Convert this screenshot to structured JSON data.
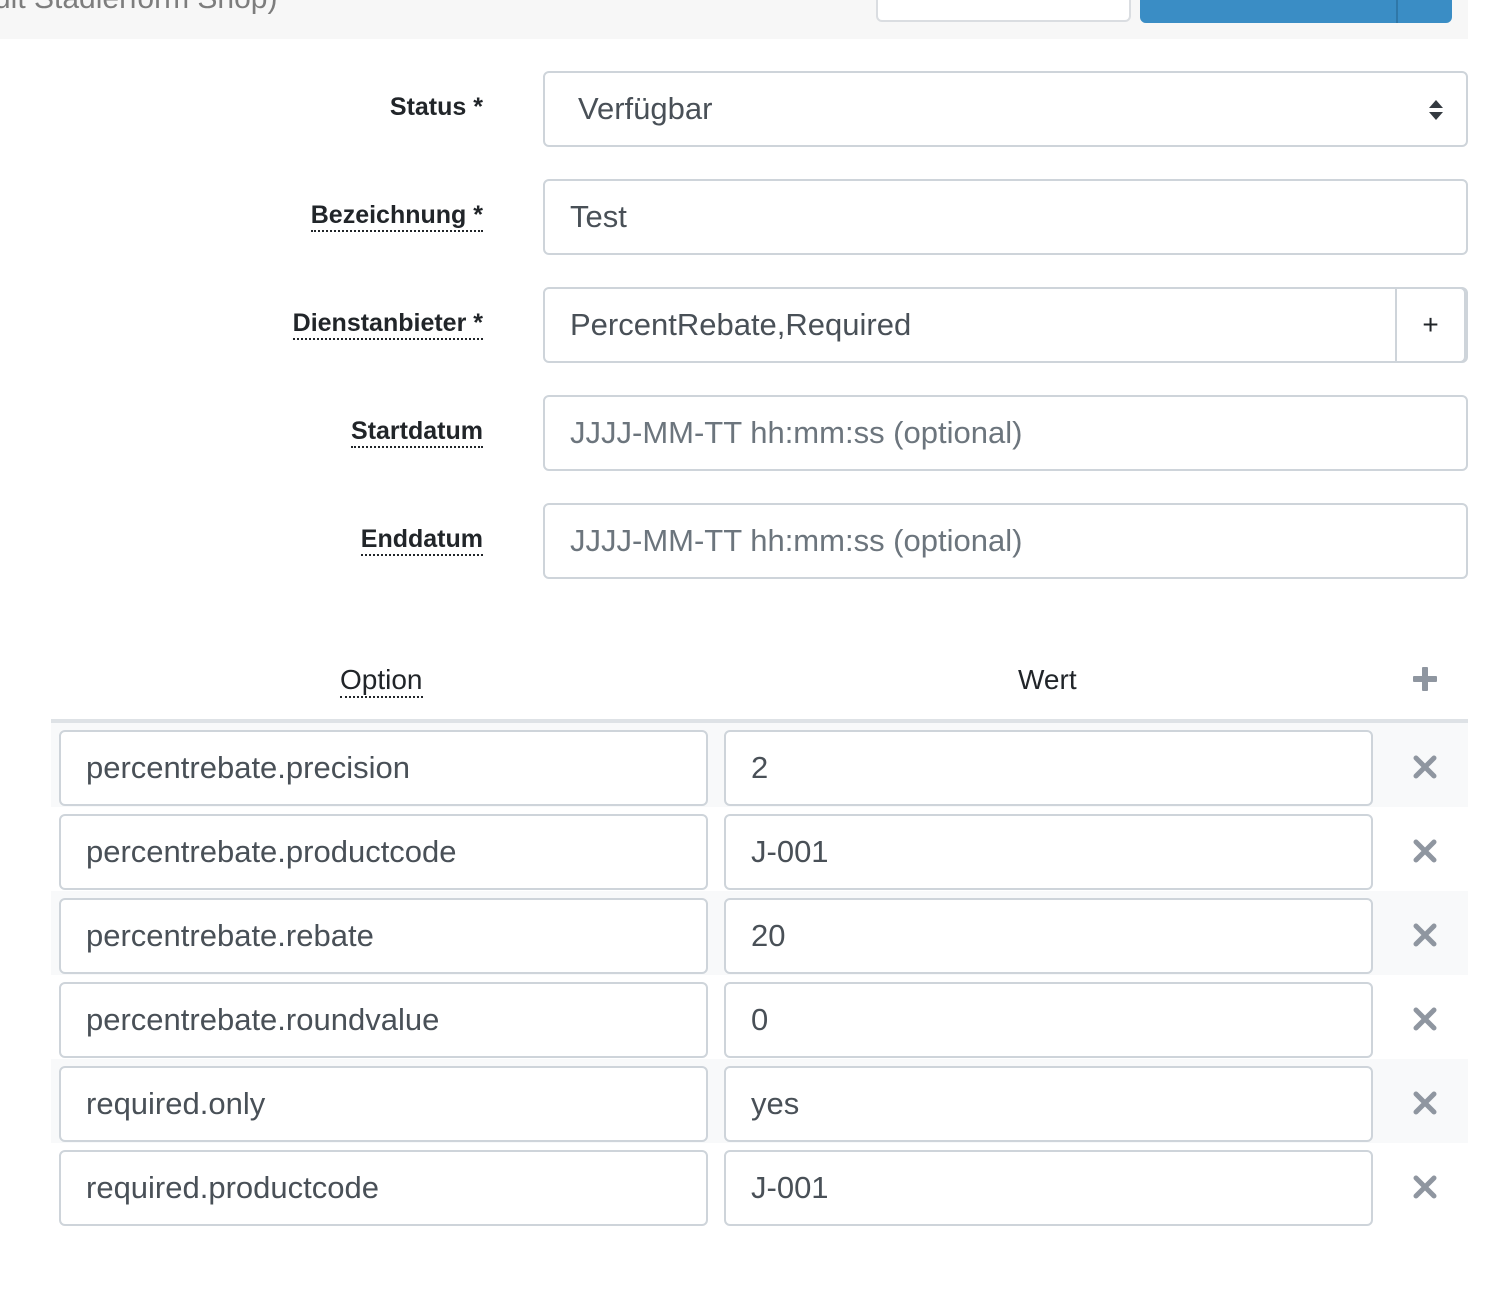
{
  "header": {
    "title": "ult Stadierform Shop)"
  },
  "form": {
    "status": {
      "label": "Status *",
      "value": "Verfügbar"
    },
    "label": {
      "label": "Bezeichnung *",
      "value": "Test"
    },
    "provider": {
      "label": "Dienstanbieter *",
      "value": "PercentRebate,Required",
      "add": "+"
    },
    "datestart": {
      "label": "Startdatum",
      "placeholder": "JJJJ-MM-TT hh:mm:ss (optional)"
    },
    "dateend": {
      "label": "Enddatum",
      "placeholder": "JJJJ-MM-TT hh:mm:ss (optional)"
    }
  },
  "options": {
    "header_option": "Option",
    "header_value": "Wert",
    "rows": [
      {
        "key": "percentrebate.precision",
        "value": "2"
      },
      {
        "key": "percentrebate.productcode",
        "value": "J-001"
      },
      {
        "key": "percentrebate.rebate",
        "value": "20"
      },
      {
        "key": "percentrebate.roundvalue",
        "value": "0"
      },
      {
        "key": "required.only",
        "value": "yes"
      },
      {
        "key": "required.productcode",
        "value": "J-001"
      }
    ]
  },
  "icons": {
    "add": "plus-icon",
    "delete": "times-icon",
    "select": "sort-arrows-icon"
  },
  "colors": {
    "primary": "#3a8dc5",
    "border": "#ced4da",
    "icon": "#8f96a0"
  }
}
